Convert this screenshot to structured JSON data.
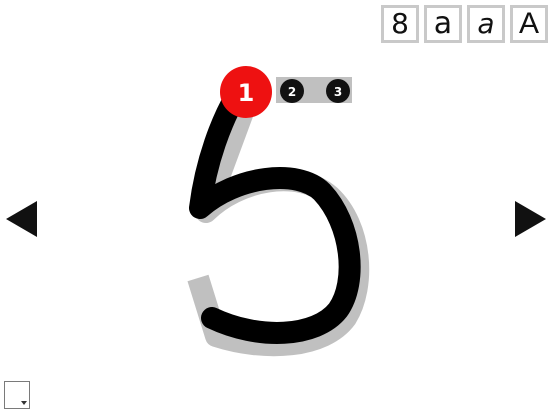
{
  "modes": [
    {
      "id": "digit",
      "label": "8"
    },
    {
      "id": "lower-a-round",
      "label": "a"
    },
    {
      "id": "lower-a-italic",
      "label": "a"
    },
    {
      "id": "upper-a",
      "label": "A"
    }
  ],
  "steps": [
    {
      "label": "1",
      "state": "active"
    },
    {
      "label": "2",
      "state": "pending"
    },
    {
      "label": "3",
      "state": "pending"
    }
  ],
  "character": "5",
  "colors": {
    "active_step": "#ee1111",
    "pending_step": "#111111",
    "guide": "#c0c0c0",
    "trace": "#000000"
  },
  "icons": {
    "previous": "triangle-left",
    "next": "triangle-right",
    "menu": "dropdown-square"
  }
}
